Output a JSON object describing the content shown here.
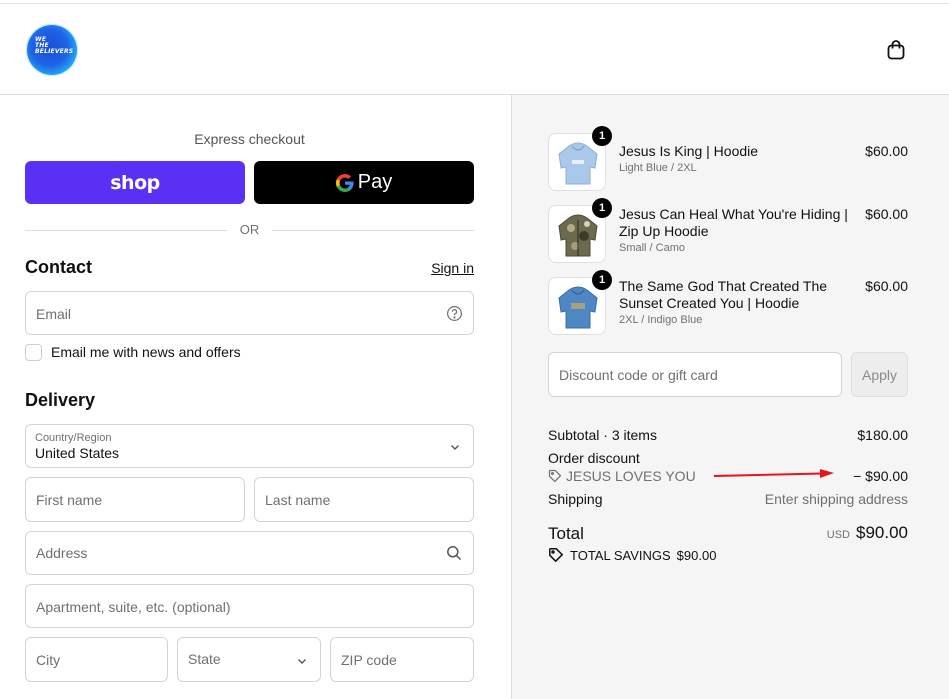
{
  "header": {
    "logo_text": "WE\nTHE\nBELIEVERS"
  },
  "express": {
    "title": "Express checkout",
    "shop_label": "shop",
    "gpay_label": "Pay",
    "or_label": "OR"
  },
  "contact": {
    "title": "Contact",
    "signin_label": "Sign in",
    "email_placeholder": "Email",
    "newsletter_label": "Email me with news and offers"
  },
  "delivery": {
    "title": "Delivery",
    "country_label": "Country/Region",
    "country_value": "United States",
    "first_name_placeholder": "First name",
    "last_name_placeholder": "Last name",
    "address_placeholder": "Address",
    "apartment_placeholder": "Apartment, suite, etc. (optional)",
    "city_placeholder": "City",
    "state_placeholder": "State",
    "zip_placeholder": "ZIP code"
  },
  "cart": {
    "items": [
      {
        "name": "Jesus Is King | Hoodie",
        "variant": "Light Blue / 2XL",
        "price": "$60.00",
        "qty": "1",
        "color": "#a9c8ea"
      },
      {
        "name": "Jesus Can Heal What You're Hiding | Zip Up Hoodie",
        "variant": "Small / Camo",
        "price": "$60.00",
        "qty": "1",
        "color": "#6b6a4e"
      },
      {
        "name": "The Same God That Created The Sunset Created You | Hoodie",
        "variant": "2XL / Indigo Blue",
        "price": "$60.00",
        "qty": "1",
        "color": "#4f86c4"
      }
    ],
    "discount_placeholder": "Discount code or gift card",
    "apply_label": "Apply"
  },
  "summary": {
    "subtotal_label": "Subtotal · 3 items",
    "subtotal_value": "$180.00",
    "order_discount_label": "Order discount",
    "discount_code": "JESUS LOVES YOU",
    "discount_value": "− $90.00",
    "shipping_label": "Shipping",
    "shipping_value": "Enter shipping address",
    "total_label": "Total",
    "total_currency": "USD",
    "total_value": "$90.00",
    "savings_label": "TOTAL SAVINGS",
    "savings_value": "$90.00"
  },
  "colors": {
    "shop_purple": "#5a31f4",
    "gpay_black": "#000000",
    "annotation_arrow": "#e8141b"
  }
}
